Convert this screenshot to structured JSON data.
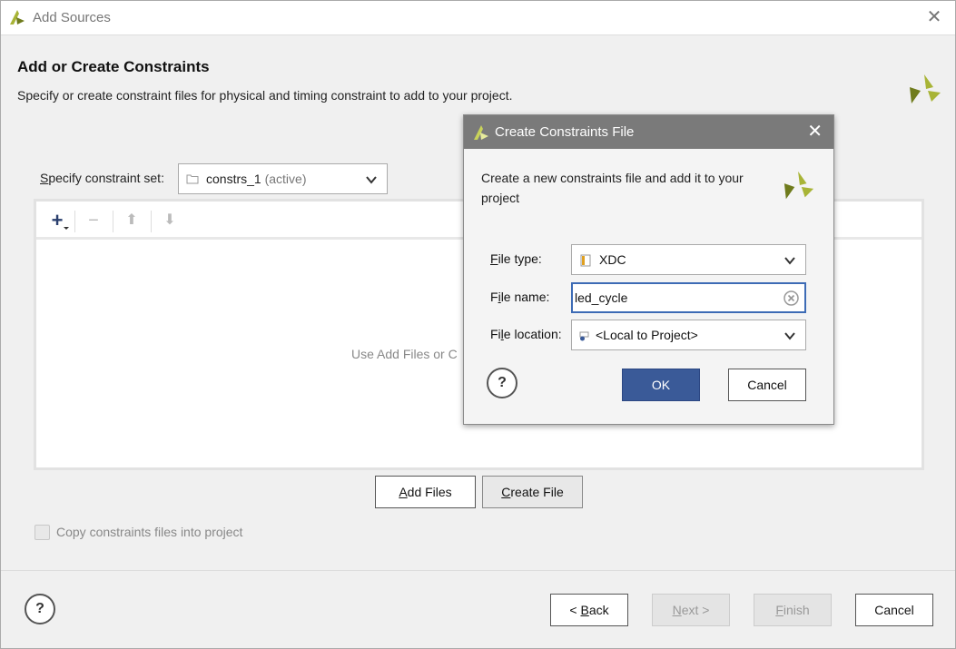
{
  "window": {
    "title": "Add Sources",
    "close_glyph": "✕"
  },
  "header": {
    "heading": "Add or Create Constraints",
    "description": "Specify or create constraint files for physical and timing constraint to add to your project."
  },
  "constraint_set": {
    "label_first": "S",
    "label_rest": "pecify constraint set:",
    "value": "constrs_1",
    "status": "(active)"
  },
  "toolbar": {
    "add_glyph": "+",
    "remove_glyph": "−",
    "up_glyph": "⬆",
    "down_glyph": "⬇"
  },
  "file_list": {
    "empty_message": "Use Add Files or C"
  },
  "buttons": {
    "add_files_u": "A",
    "add_files_rest": "dd Files",
    "create_file_u": "C",
    "create_file_rest": "reate File"
  },
  "copy_option": {
    "label": "Copy constraints files into project",
    "checked": false
  },
  "footer": {
    "help": "?",
    "back_prefix": "< ",
    "back_u": "B",
    "back_rest": "ack",
    "next_u": "N",
    "next_rest": "ext >",
    "finish_u": "F",
    "finish_rest": "inish",
    "cancel": "Cancel"
  },
  "dialog": {
    "title": "Create Constraints File",
    "close_glyph": "✕",
    "description": "Create a new constraints file and add it to your project",
    "file_type": {
      "label_u": "F",
      "label_rest": "ile type:",
      "value": "XDC"
    },
    "file_name": {
      "label_u": "i",
      "label_pre": "F",
      "label_rest": "le name:",
      "value": "led_cycle"
    },
    "file_location": {
      "label_pre": "Fi",
      "label_u": "l",
      "label_rest": "e location:",
      "value": "<Local to Project>"
    },
    "help": "?",
    "ok": "OK",
    "cancel": "Cancel"
  },
  "colors": {
    "brand_logo": "#a8b436",
    "brand_logo_dark": "#6f7b1c",
    "primary_button": "#3a5a98",
    "dialog_titlebar": "#7a7a7a",
    "input_focus": "#3d6bb5"
  }
}
